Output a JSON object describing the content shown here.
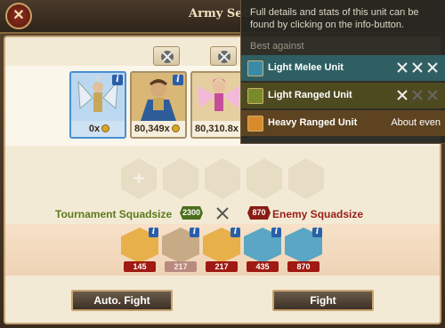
{
  "header": {
    "title": "Army Setu"
  },
  "army": {
    "units": [
      {
        "count": "0x",
        "selected": true
      },
      {
        "count": "80,349x"
      },
      {
        "count": "80,310.8x"
      }
    ]
  },
  "squad": {
    "tournament_label": "Tournament Squadsize",
    "tournament_value": "2300",
    "enemy_value": "870",
    "enemy_label": "Enemy Squadsize"
  },
  "enemy_units": [
    {
      "type": "heavy-ranged",
      "count": "145"
    },
    {
      "type": "heavy-melee",
      "count": "217"
    },
    {
      "type": "heavy-ranged",
      "count": "217"
    },
    {
      "type": "light-melee",
      "count": "435"
    },
    {
      "type": "light-melee",
      "count": "870"
    }
  ],
  "buttons": {
    "auto_fight": "Auto. Fight",
    "fight": "Fight"
  },
  "tooltip": {
    "description": "Full details and stats of this unit can be found by clicking on the info-button.",
    "best_against": "Best against",
    "rows": [
      {
        "label": "Light Melee Unit",
        "strength": 3,
        "color": "#2f5f62"
      },
      {
        "label": "Light Ranged Unit",
        "strength": 1,
        "color": "#4d4a1f"
      },
      {
        "label": "Heavy Ranged Unit",
        "value": "About even",
        "color": "#5e4320"
      }
    ]
  },
  "colors": {
    "accent": "#c8a470",
    "tournament": "#5b7a1a",
    "enemy": "#9a2018"
  }
}
